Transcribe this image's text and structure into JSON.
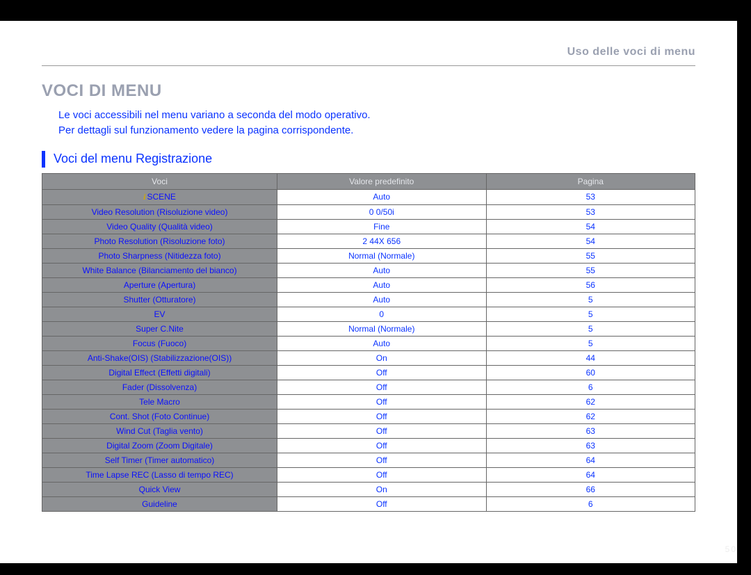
{
  "header_right": "Uso delle voci di menu",
  "title": "VOCI DI MENU",
  "intro_line1": "Le voci accessibili nel menu variano a seconda del modo operativo.",
  "intro_line2": "Per dettagli sul funzionamento vedere la pagina corrispondente.",
  "section_heading": "Voci del menu Registrazione",
  "table": {
    "headers": {
      "c1": "Voci",
      "c2": "Valore predefinito",
      "c3": "Pagina"
    },
    "rows": [
      {
        "item": "SCENE",
        "default": "Auto",
        "page": "53",
        "icon": "i"
      },
      {
        "item": "Video Resolution (Risoluzione video)",
        "default": "0 0/50i",
        "page": "53"
      },
      {
        "item": "Video Quality (Qualità video)",
        "default": "Fine",
        "page": "54"
      },
      {
        "item": "Photo Resolution (Risoluzione foto)",
        "default": "2 44X 656",
        "page": "54"
      },
      {
        "item": "Photo Sharpness (Nitidezza foto)",
        "default": "Normal (Normale)",
        "page": "55"
      },
      {
        "item": "White Balance (Bilanciamento del bianco)",
        "default": "Auto",
        "page": "55"
      },
      {
        "item": "Aperture (Apertura)",
        "default": "Auto",
        "page": "56"
      },
      {
        "item": "Shutter (Otturatore)",
        "default": "Auto",
        "page": "5"
      },
      {
        "item": "EV",
        "default": "0",
        "page": "5"
      },
      {
        "item": "Super C.Nite",
        "default": "Normal (Normale)",
        "page": "5"
      },
      {
        "item": "Focus (Fuoco)",
        "default": "Auto",
        "page": "5"
      },
      {
        "item": "Anti-Shake(OIS) (Stabilizzazione(OIS))",
        "default": "On",
        "page": "44"
      },
      {
        "item": "Digital Effect (Effetti digitali)",
        "default": "Off",
        "page": "60"
      },
      {
        "item": "Fader (Dissolvenza)",
        "default": "Off",
        "page": "6"
      },
      {
        "item": "Tele Macro",
        "default": "Off",
        "page": "62"
      },
      {
        "item": "Cont. Shot (Foto Continue)",
        "default": "Off",
        "page": "62"
      },
      {
        "item": "Wind Cut (Taglia vento)",
        "default": "Off",
        "page": "63"
      },
      {
        "item": "Digital Zoom (Zoom Digitale)",
        "default": "Off",
        "page": "63"
      },
      {
        "item": "Self Timer (Timer automatico)",
        "default": "Off",
        "page": "64"
      },
      {
        "item": "Time Lapse REC (Lasso di tempo REC)",
        "default": "Off",
        "page": "64"
      },
      {
        "item": "Quick View",
        "default": "On",
        "page": "66"
      },
      {
        "item": "Guideline",
        "default": "Off",
        "page": "6"
      }
    ]
  },
  "page_number": "50"
}
